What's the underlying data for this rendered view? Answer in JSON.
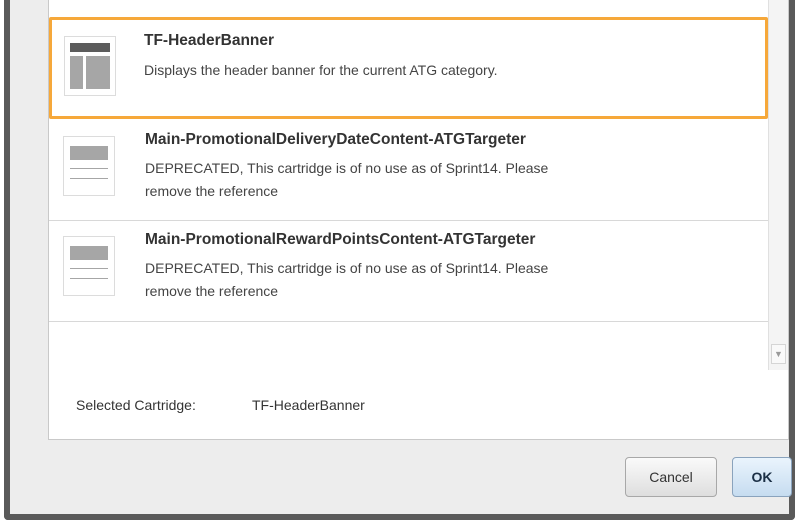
{
  "cartridges": [
    {
      "name": "TF-HeaderBanner",
      "description": "Displays the header banner for the current ATG category.",
      "thumbnail_icon": "header-banner-layout-icon",
      "selected": true
    },
    {
      "name": "Main-PromotionalDeliveryDateContent-ATGTargeter",
      "description_line1": "DEPRECATED, This cartridge is of no use as of Sprint14. Please",
      "description_line2": "remove the reference",
      "thumbnail_icon": "content-block-layout-icon",
      "selected": false
    },
    {
      "name": "Main-PromotionalRewardPointsContent-ATGTargeter",
      "description_line1": "DEPRECATED, This cartridge is of no use as of Sprint14. Please",
      "description_line2": "remove the reference",
      "thumbnail_icon": "content-block-layout-icon",
      "selected": false
    }
  ],
  "footer": {
    "label": "Selected Cartridge:",
    "value": "TF-HeaderBanner"
  },
  "buttons": {
    "cancel": "Cancel",
    "ok": "OK"
  },
  "colors": {
    "selected_border": "#f6a83a",
    "highlight": "#fbf103",
    "dialog_frame": "#5a5a5a"
  }
}
